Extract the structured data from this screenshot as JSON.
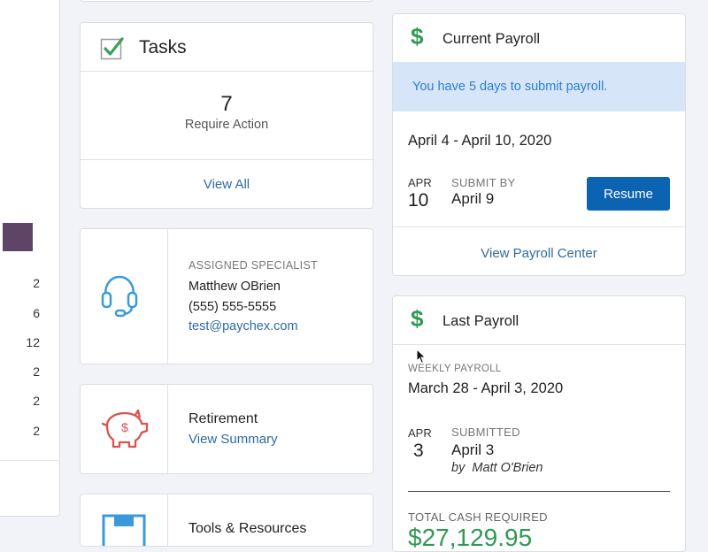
{
  "left_panel": {
    "swatch_color": "#5e4568",
    "values": [
      "2",
      "6",
      "12",
      "2",
      "2",
      "2"
    ]
  },
  "tasks": {
    "title": "Tasks",
    "count": "7",
    "subtitle": "Require Action",
    "link": "View All"
  },
  "specialist": {
    "label": "ASSIGNED SPECIALIST",
    "name": "Matthew OBrien",
    "phone": "(555) 555-5555",
    "email": "test@paychex.com",
    "icon": "headset-icon"
  },
  "retirement": {
    "title": "Retirement",
    "link": "View Summary",
    "icon": "piggy-bank-icon"
  },
  "tools": {
    "title": "Tools & Resources",
    "icon": "tools-icon"
  },
  "current_payroll": {
    "title": "Current Payroll",
    "banner": "You have 5 days to submit payroll.",
    "period": "April 4 - April 10, 2020",
    "month": "APR",
    "day": "10",
    "submit_label": "SUBMIT BY",
    "submit_date": "April 9",
    "resume_label": "Resume",
    "center_link": "View Payroll Center",
    "accent": "#0b63b2",
    "banner_bg": "#d6e6f8"
  },
  "last_payroll": {
    "title": "Last Payroll",
    "type_label": "WEEKLY PAYROLL",
    "period": "March 28 - April 3, 2020",
    "month": "APR",
    "day": "3",
    "status_label": "SUBMITTED",
    "status_date": "April 3",
    "by": "by  Matt O'Brien",
    "total_label": "TOTAL CASH REQUIRED",
    "total_value": "$27,129.95"
  },
  "colors": {
    "dollar": "#2e9a52",
    "check": "#3aa05a",
    "link": "#2f6aa3",
    "headset": "#3a9ad9",
    "piggy": "#d9534f"
  }
}
